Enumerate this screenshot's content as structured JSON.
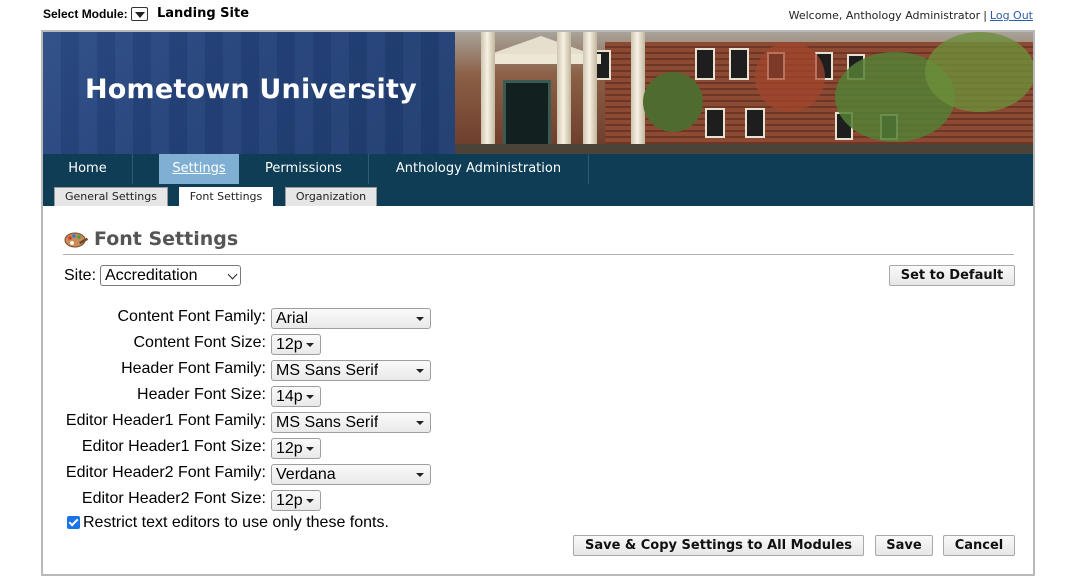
{
  "topbar": {
    "module_label": "Select Module:",
    "module_name": "Landing Site",
    "welcome_text": "Welcome, Anthology Administrator",
    "separator": "|",
    "logout_label": "Log Out"
  },
  "banner": {
    "title": "Hometown University"
  },
  "nav": {
    "items": [
      {
        "label": "Home"
      },
      {
        "label": "Settings",
        "active": true
      },
      {
        "label": "Permissions"
      },
      {
        "label": "Anthology Administration"
      }
    ]
  },
  "subnav": {
    "tabs": [
      {
        "label": "General Settings"
      },
      {
        "label": "Font Settings",
        "active": true
      },
      {
        "label": "Organization"
      }
    ]
  },
  "page": {
    "title": "Font Settings",
    "site_label": "Site:",
    "site_value": "Accreditation",
    "set_default_label": "Set to Default"
  },
  "fields": [
    {
      "label": "Content Font Family:",
      "value": "Arial"
    },
    {
      "label": "Content Font Size:",
      "value": "12p"
    },
    {
      "label": "Header Font Family:",
      "value": "MS Sans Serif"
    },
    {
      "label": "Header Font Size:",
      "value": "14p"
    },
    {
      "label": "Editor Header1 Font Family:",
      "value": "MS Sans Serif"
    },
    {
      "label": "Editor Header1 Font Size:",
      "value": "12p"
    },
    {
      "label": "Editor Header2 Font Family:",
      "value": "Verdana"
    },
    {
      "label": "Editor Header2 Font Size:",
      "value": "12p"
    }
  ],
  "restrict": {
    "label": "Restrict text editors to use only these fonts.",
    "checked": true
  },
  "actions": {
    "save_copy_label": "Save & Copy Settings to All Modules",
    "save_label": "Save",
    "cancel_label": "Cancel"
  },
  "colors": {
    "nav_bg": "#0e3d55",
    "nav_active": "#7fb0d4",
    "banner_blue": "#24427a",
    "link": "#2a5fb0",
    "checkbox": "#1a73e8"
  }
}
